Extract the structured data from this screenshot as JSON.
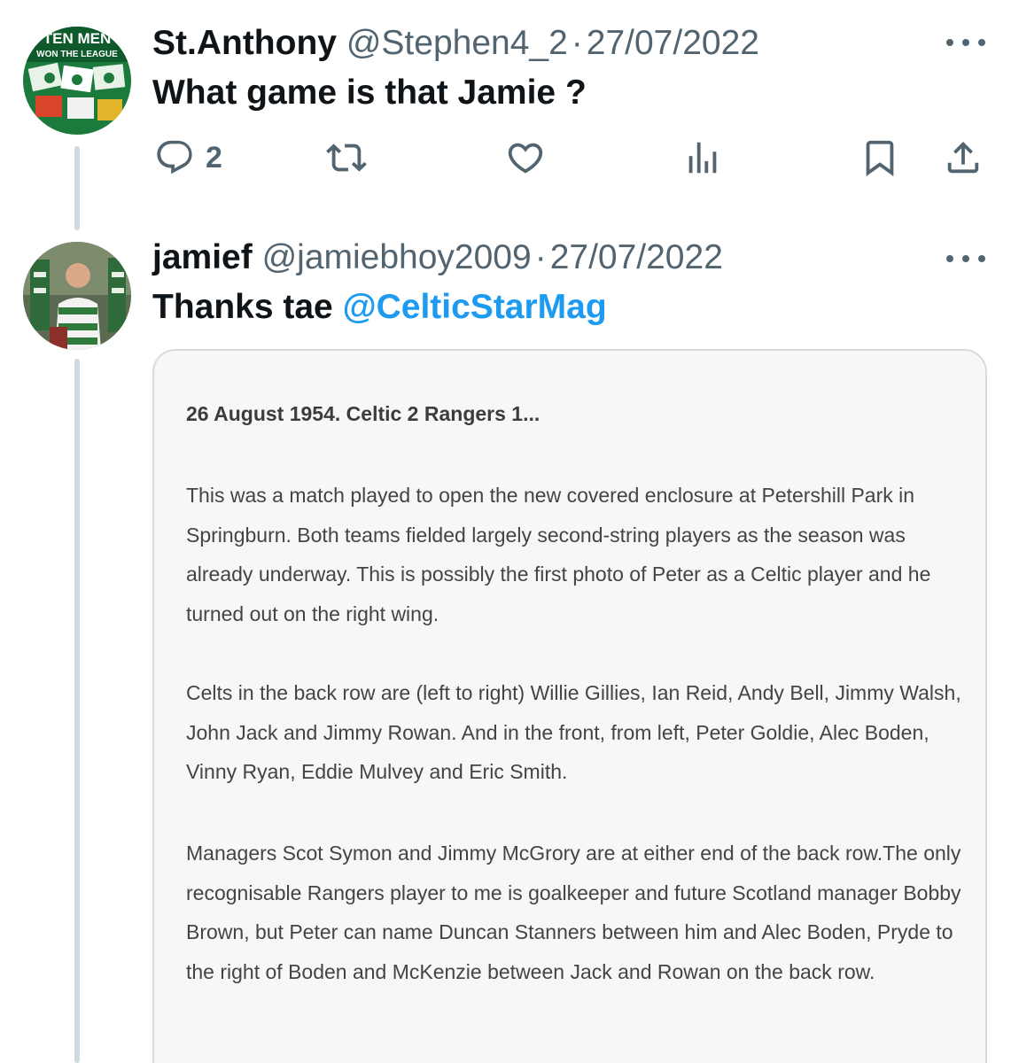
{
  "tweets": [
    {
      "display_name": "St.Anthony",
      "handle": "@Stephen4_2",
      "separator": "·",
      "date": "27/07/2022",
      "text": "What game is that Jamie ?",
      "avatar": {
        "banner_line1": "TEN MEN",
        "banner_line2": "WON THE LEAGUE"
      },
      "actions": {
        "reply_count": "2",
        "retweet_count": "",
        "like_count": ""
      }
    },
    {
      "display_name": "jamief",
      "handle": "@jamiebhoy2009",
      "separator": "·",
      "date": "27/07/2022",
      "text_prefix": "Thanks tae ",
      "mention": "@CelticStarMag",
      "card": {
        "title": "26 August 1954. Celtic 2 Rangers 1...",
        "paragraphs": [
          "This was a match played to open the new covered enclosure at Petershill Park in Springburn. Both teams fielded largely second-string players as the season was already underway. This is possibly the first photo of Peter as a Celtic player and he turned out on the right wing.",
          "Celts in the back row are (left to right) Willie Gillies, Ian Reid, Andy Bell, Jimmy Walsh, John Jack and Jimmy Rowan. And in the front, from left, Peter Goldie, Alec Boden, Vinny Ryan, Eddie Mulvey and Eric Smith.",
          "Managers Scot Symon and Jimmy McGrory are at either end of the back row.The only recognisable Rangers player to me is goalkeeper and future Scotland manager Bobby Brown, but Peter can name Duncan Stanners between him and Alec Boden, Pryde to the right of Boden and McKenzie between Jack and Rowan on the back row."
        ]
      }
    }
  ],
  "colors": {
    "text_primary": "#0f1419",
    "text_secondary": "#536471",
    "link": "#1d9bf0",
    "thread_line": "#cfd9de",
    "card_bg": "#f7f7f8"
  },
  "icons": [
    "reply-icon",
    "retweet-icon",
    "like-icon",
    "views-icon",
    "bookmark-icon",
    "share-icon",
    "more-icon"
  ]
}
